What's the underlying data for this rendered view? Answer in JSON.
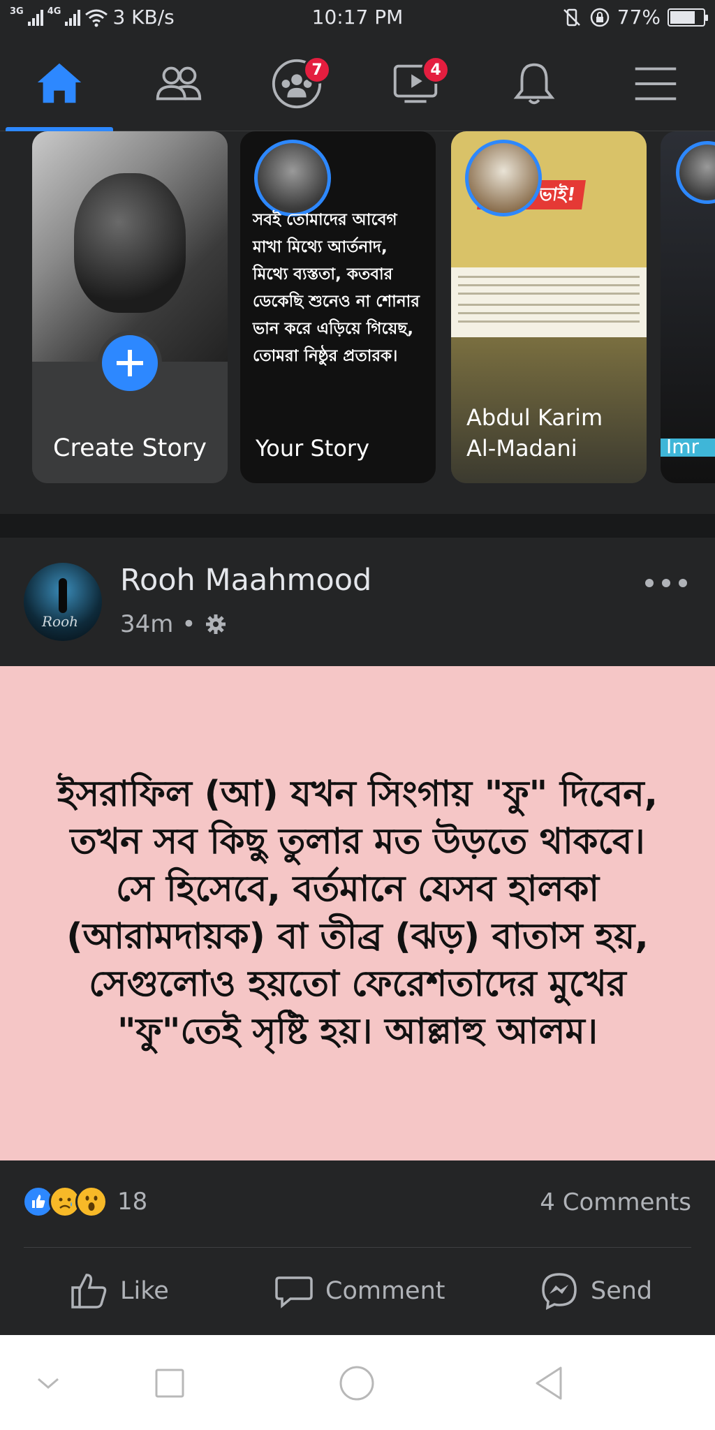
{
  "status_bar": {
    "network_1": "3G",
    "network_2": "4G",
    "speed": "3 KB/s",
    "time": "10:17 PM",
    "battery": "77%",
    "battery_level": 0.77
  },
  "nav": {
    "icons": [
      "home-icon",
      "friends-icon",
      "groups-icon",
      "watch-icon",
      "notifications-icon",
      "menu-icon"
    ],
    "groups_badge": "7",
    "watch_badge": "4",
    "accent": "#2d88ff"
  },
  "stories": {
    "create_label": "Create Story",
    "your_story_label": "Your Story",
    "your_story_text": "সবই তোমাদের আবেগ মাখা মিথ্যে আর্তনাদ, মিথ্যে ব্যস্ততা, কতবার ডেকেছি শুনেও না শোনার ভান করে এড়িয়ে গিয়েছ, তোমরা নিষ্ঠুর প্রতারক।",
    "friend_label": "Abdul Karim Al-Madani",
    "friend_banner": "ভাই!",
    "fourth_label": "Imr"
  },
  "post": {
    "author": "Rooh Maahmood",
    "avatar_signature": "Rooh",
    "time": "34m",
    "privacy_icon": "gear-icon",
    "text": "ইসরাফিল (আ) যখন সিংগায় \"ফু\" দিবেন, তখন সব কিছু তুলার মত উড়তে থাকবে। সে হিসেবে, বর্তমানে যেসব হালকা (আরামদায়ক) বা তীব্র (ঝড়) বাতাস হয়, সেগুলোও হয়তো ফেরেশতাদের মুখের \"ফু\"তেই সৃষ্টি হয়। আল্লাহু আলম।",
    "background": "#f5c6c6",
    "reaction_count": "18",
    "comments": "4 Comments",
    "actions": {
      "like": "Like",
      "comment": "Comment",
      "send": "Send"
    }
  },
  "system_nav": {
    "icons": [
      "chevron-down-icon",
      "square-icon",
      "circle-icon",
      "back-triangle-icon"
    ]
  }
}
